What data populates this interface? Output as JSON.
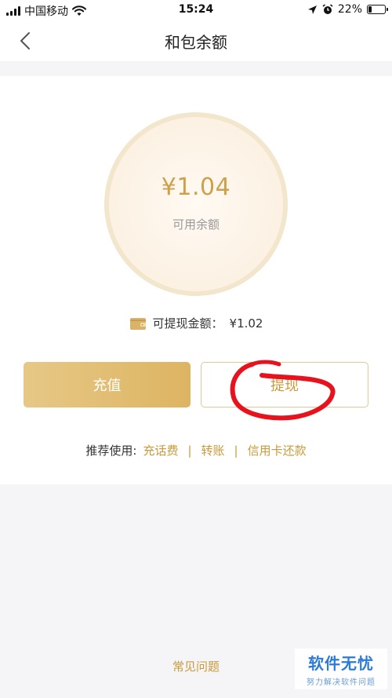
{
  "status_bar": {
    "carrier": "中国移动",
    "time": "15:24",
    "battery": "22%",
    "battery_level": 0.22
  },
  "nav": {
    "title": "和包余额"
  },
  "balance": {
    "amount": "¥1.04",
    "label": "可用余额"
  },
  "withdrawable": {
    "label": "可提现金额：",
    "amount": "¥1.02"
  },
  "actions": {
    "recharge_label": "充值",
    "withdraw_label": "提现"
  },
  "recommend": {
    "label": "推荐使用:",
    "separator": "|",
    "items": [
      "充话费",
      "转账",
      "信用卡还款"
    ]
  },
  "footer": {
    "faq_label": "常见问题"
  },
  "watermark": {
    "main": "软件无忧",
    "sub": "努力解决软件问题"
  },
  "colors": {
    "accent_gold": "#c99a3b",
    "button_gold": "#ddb462",
    "annotation_red": "#e8121e"
  }
}
